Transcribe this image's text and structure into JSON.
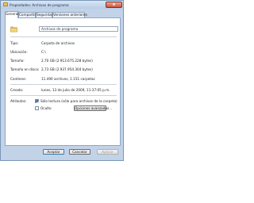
{
  "window": {
    "title": "Propiedades: Archivos de programa",
    "close_label": "x"
  },
  "tabs": [
    {
      "label": "General"
    },
    {
      "label": "Compartir"
    },
    {
      "label": "Seguridad"
    },
    {
      "label": "Versiones anteriores"
    }
  ],
  "general": {
    "name_value": "Archivos de programa",
    "rows": {
      "type": {
        "label": "Tipo:",
        "value": "Carpeta de archivos"
      },
      "location": {
        "label": "Ubicación:",
        "value": "C:\\"
      },
      "size": {
        "label": "Tamaño:",
        "value": "2,70 GB (2.913.675.228 bytes)"
      },
      "size_on_disk": {
        "label": "Tamaño en disco:",
        "value": "2,73 GB (2.937.954.304 bytes)"
      },
      "contains": {
        "label": "Contiene:",
        "value": "11.490 archivos, 1.151 carpetas"
      },
      "created": {
        "label": "Creado:",
        "value": "lunes, 13 de julio de 2009, 11:37:05 p.m."
      }
    },
    "attributes": {
      "label": "Atributos:",
      "readonly_label": "Sólo lectura (sólo para archivos de la carpeta)",
      "readonly_checked": true,
      "hidden_label": "Oculto",
      "hidden_checked": false,
      "advanced_button": "Opciones avanzadas..."
    }
  },
  "footer": {
    "ok": "Aceptar",
    "cancel": "Cancelar",
    "apply": "Aplicar"
  }
}
